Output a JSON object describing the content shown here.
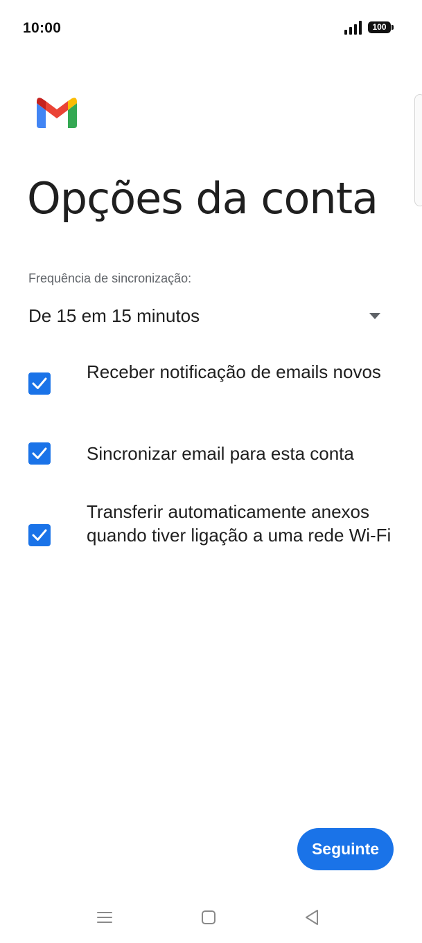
{
  "status_bar": {
    "time": "10:00",
    "battery_level": "100",
    "icons": [
      "signal-icon",
      "battery-icon"
    ]
  },
  "header": {
    "logo": "gmail-logo",
    "title": "Opções da conta"
  },
  "sync": {
    "label": "Frequência de sincronização:",
    "selected_value": "De 15 em 15 minutos",
    "icon": "dropdown-arrow-icon"
  },
  "options": [
    {
      "label": "Receber notificação de emails novos",
      "checked": true
    },
    {
      "label": "Sincronizar email para esta conta",
      "checked": true
    },
    {
      "label": "Transferir automaticamente anexos quando tiver ligação a uma rede Wi-Fi",
      "checked": true
    }
  ],
  "actions": {
    "next_label": "Seguinte"
  },
  "nav_bar": {
    "icons": [
      "menu-icon",
      "home-icon",
      "back-icon"
    ]
  },
  "colors": {
    "accent": "#1a73e8",
    "text": "#1f1f1f",
    "secondary_text": "#5f6368"
  }
}
